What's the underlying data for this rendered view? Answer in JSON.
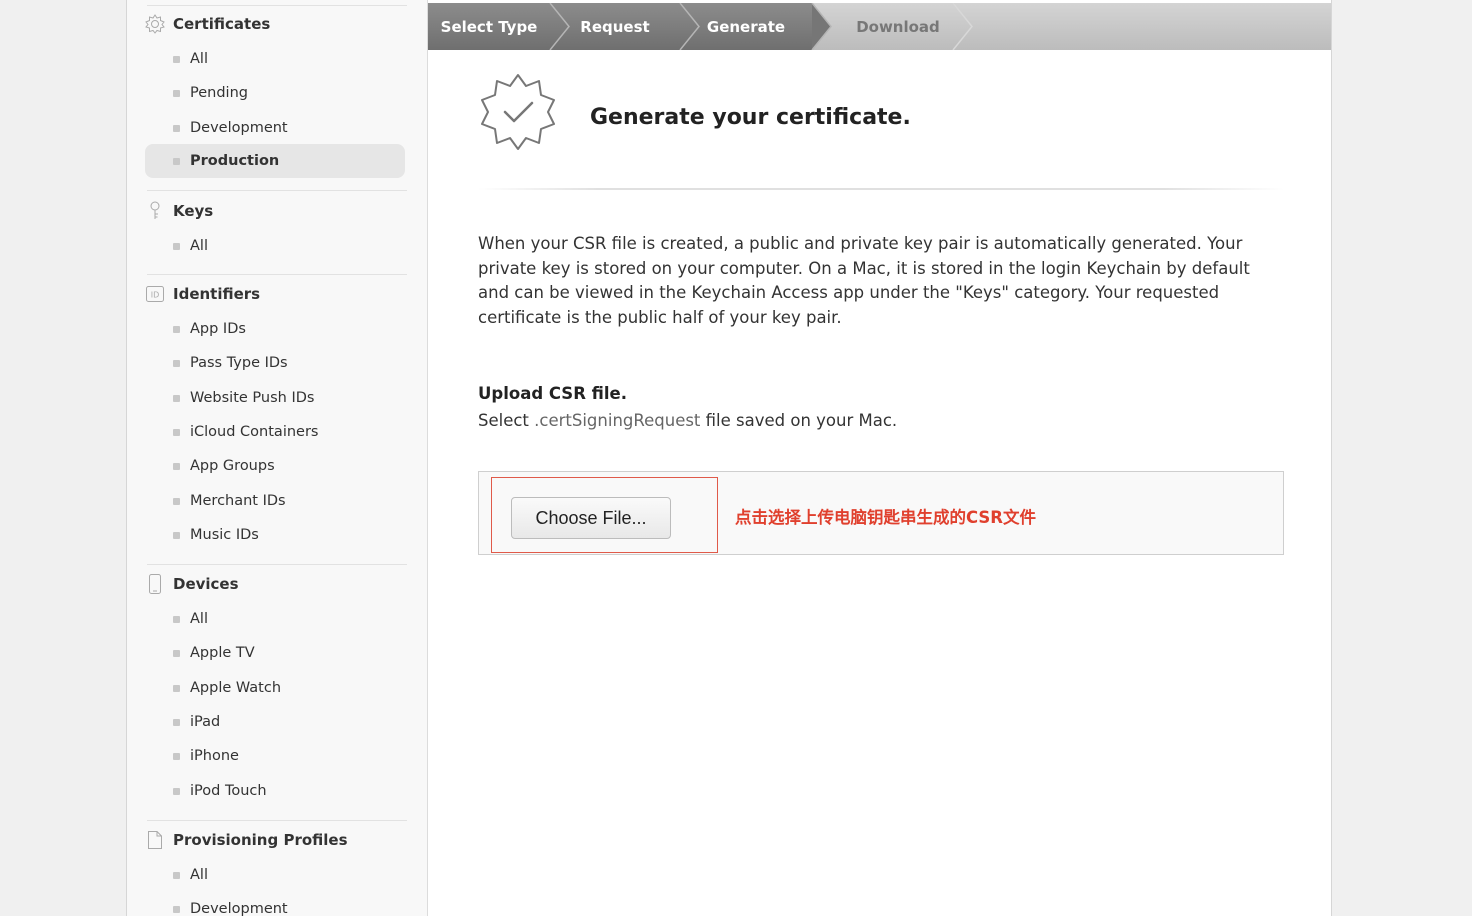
{
  "sidebar": {
    "sections": [
      {
        "title": "Certificates",
        "icon": "gear-cert-icon",
        "items": [
          "All",
          "Pending",
          "Development",
          "Production"
        ],
        "active": "Production"
      },
      {
        "title": "Keys",
        "icon": "key-icon",
        "items": [
          "All"
        ]
      },
      {
        "title": "Identifiers",
        "icon": "id-icon",
        "items": [
          "App IDs",
          "Pass Type IDs",
          "Website Push IDs",
          "iCloud Containers",
          "App Groups",
          "Merchant IDs",
          "Music IDs"
        ]
      },
      {
        "title": "Devices",
        "icon": "device-icon",
        "items": [
          "All",
          "Apple TV",
          "Apple Watch",
          "iPad",
          "iPhone",
          "iPod Touch"
        ]
      },
      {
        "title": "Provisioning Profiles",
        "icon": "document-icon",
        "items": [
          "All",
          "Development"
        ]
      }
    ]
  },
  "steps": [
    "Select Type",
    "Request",
    "Generate",
    "Download"
  ],
  "active_step": "Generate",
  "main": {
    "title": "Generate your certificate.",
    "description": "When your CSR file is created, a public and private key pair is automatically generated. Your private key is stored on your computer. On a Mac, it is stored in the login Keychain by default and can be viewed in the Keychain Access app under the \"Keys\" category. Your requested certificate is the public half of your key pair.",
    "upload_title": "Upload CSR file.",
    "upload_sub_prefix": "Select ",
    "upload_sub_ext": ".certSigningRequest",
    "upload_sub_suffix": " file saved on your Mac.",
    "choose_label": "Choose File...",
    "annotation": "点击选择上传电脑钥匙串生成的CSR文件"
  },
  "colors": {
    "accent_annotation": "#e0402e",
    "active_step": "#7a7a7a"
  }
}
